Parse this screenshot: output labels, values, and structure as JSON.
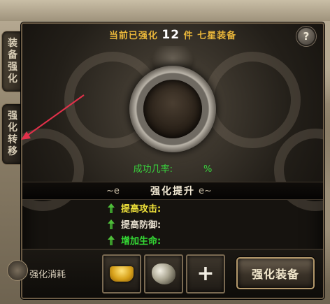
{
  "header": {
    "prefix": "当前已强化",
    "count": "12",
    "suffix": "件 七星装备",
    "help_label": "?"
  },
  "side_tabs": [
    {
      "chars": [
        "装",
        "备",
        "强",
        "化"
      ]
    },
    {
      "chars": [
        "强",
        "化",
        "转",
        "移"
      ]
    }
  ],
  "success": {
    "label": "成功几率:",
    "value": "%"
  },
  "boost": {
    "title": "强化提升",
    "left_flourish": "~e",
    "right_flourish": "e~",
    "items": [
      {
        "label": "提高攻击:",
        "color": "#f0e23a"
      },
      {
        "label": "提高防御:",
        "color": "#e7dfcf"
      },
      {
        "label": "增加生命:",
        "color": "#34d834"
      }
    ]
  },
  "cost": {
    "label": "强化消耗",
    "items": [
      "gold-ingot-icon",
      "ore-icon",
      "plus-icon"
    ],
    "plus_symbol": "+"
  },
  "actions": {
    "enhance_label": "强化装备"
  },
  "colors": {
    "title_gold": "#e9b63a",
    "success_green": "#39d33d",
    "panel_border": "#6b5b45"
  }
}
